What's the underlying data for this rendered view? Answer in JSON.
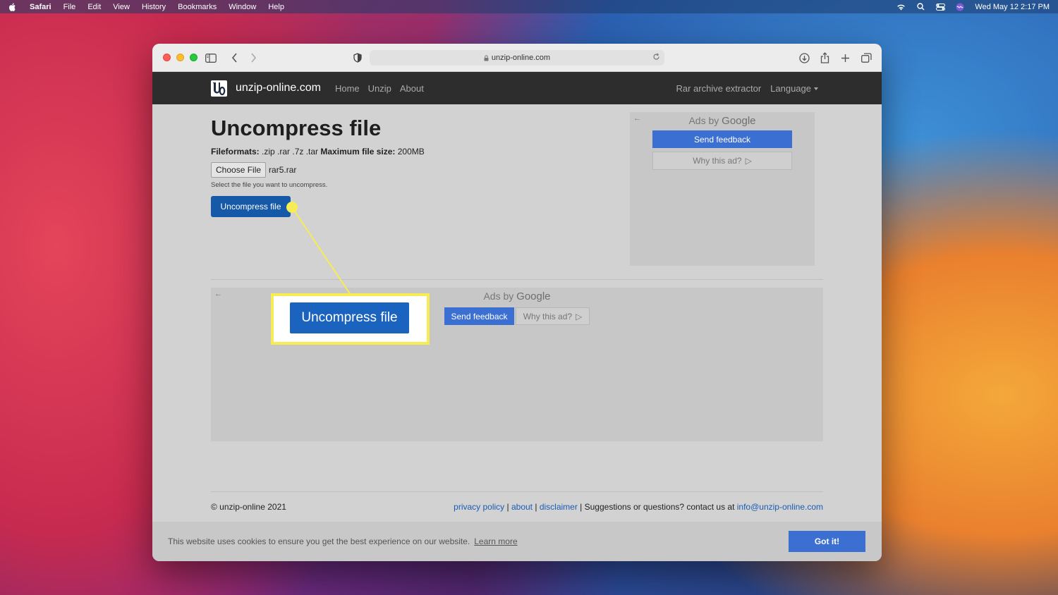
{
  "menubar": {
    "items": [
      "Safari",
      "File",
      "Edit",
      "View",
      "History",
      "Bookmarks",
      "Window",
      "Help"
    ],
    "clock": "Wed May 12  2:17 PM"
  },
  "browser": {
    "url": "unzip-online.com"
  },
  "site": {
    "brand": "unzip-online.com",
    "nav": {
      "home": "Home",
      "unzip": "Unzip",
      "about": "About",
      "rar": "Rar archive extractor",
      "language": "Language"
    }
  },
  "main": {
    "title": "Uncompress file",
    "formats_label": "Fileformats:",
    "formats_value": " .zip .rar .7z .tar ",
    "max_label": "Maximum file size:",
    "max_value": " 200MB",
    "choose_file": "Choose File",
    "file_name": "rar5.rar",
    "hint": "Select the file you want to uncompress.",
    "submit": "Uncompress file"
  },
  "ads": {
    "ads_by": "Ads by",
    "google": "Google",
    "send_feedback": "Send feedback",
    "why": "Why this ad?"
  },
  "footer": {
    "copyright": "© unzip-online 2021",
    "privacy": "privacy policy",
    "sep1": " | ",
    "about": "about",
    "sep2": " | ",
    "disclaimer": "disclaimer",
    "contact_text": " | Suggestions or questions? contact us at ",
    "email": "info@unzip-online.com"
  },
  "cookie": {
    "text": "This website uses cookies to ensure you get the best experience on our website.",
    "learn_more": "Learn more",
    "got_it": "Got it!"
  },
  "callout": {
    "label": "Uncompress file"
  },
  "colors": {
    "primary": "#1559a8",
    "ad_button": "#3b6fd1",
    "highlight": "#f8ec54",
    "nav_bg": "#2d2d2d"
  }
}
